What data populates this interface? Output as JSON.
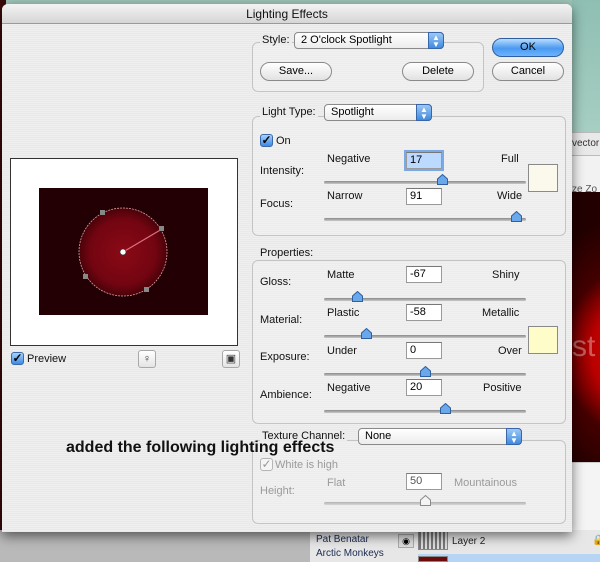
{
  "window": {
    "title": "Lighting Effects"
  },
  "style": {
    "label": "Style:",
    "selected": "2 O'clock Spotlight",
    "save_label": "Save...",
    "delete_label": "Delete"
  },
  "buttons": {
    "ok": "OK",
    "cancel": "Cancel"
  },
  "light_type": {
    "label": "Light Type:",
    "selected": "Spotlight",
    "on_label": "On",
    "on_checked": true,
    "light_color": "#fbf9ec",
    "intensity": {
      "label": "Intensity:",
      "min_label": "Negative",
      "max_label": "Full",
      "value": "17",
      "range": [
        -100,
        100
      ]
    },
    "focus": {
      "label": "Focus:",
      "min_label": "Narrow",
      "max_label": "Wide",
      "value": "91",
      "range": [
        -100,
        100
      ]
    }
  },
  "properties": {
    "label": "Properties:",
    "ambient_color": "#fefcc8",
    "gloss": {
      "label": "Gloss:",
      "min_label": "Matte",
      "max_label": "Shiny",
      "value": "-67",
      "range": [
        -100,
        100
      ]
    },
    "material": {
      "label": "Material:",
      "min_label": "Plastic",
      "max_label": "Metallic",
      "value": "-58",
      "range": [
        -100,
        100
      ]
    },
    "exposure": {
      "label": "Exposure:",
      "min_label": "Under",
      "max_label": "Over",
      "value": "0",
      "range": [
        -100,
        100
      ]
    },
    "ambience": {
      "label": "Ambience:",
      "min_label": "Negative",
      "max_label": "Positive",
      "value": "20",
      "range": [
        -100,
        100
      ]
    }
  },
  "texture": {
    "label": "Texture Channel:",
    "selected": "None",
    "white_is_high_label": "White is high",
    "height": {
      "label": "Height:",
      "min_label": "Flat",
      "max_label": "Mountainous",
      "value": "50",
      "range": [
        0,
        100
      ]
    }
  },
  "preview": {
    "label": "Preview",
    "checked": true,
    "light_icon": "lightbulb-icon",
    "delete_icon": "trash-icon"
  },
  "caption": "added the following lighting effects",
  "background": {
    "header_text": "vector",
    "toolbar_text": "ze Zo",
    "canvas_text": "st",
    "layers": [
      "Pat Benatar",
      "Arctic Monkeys"
    ],
    "layer_label": "Layer 2"
  }
}
